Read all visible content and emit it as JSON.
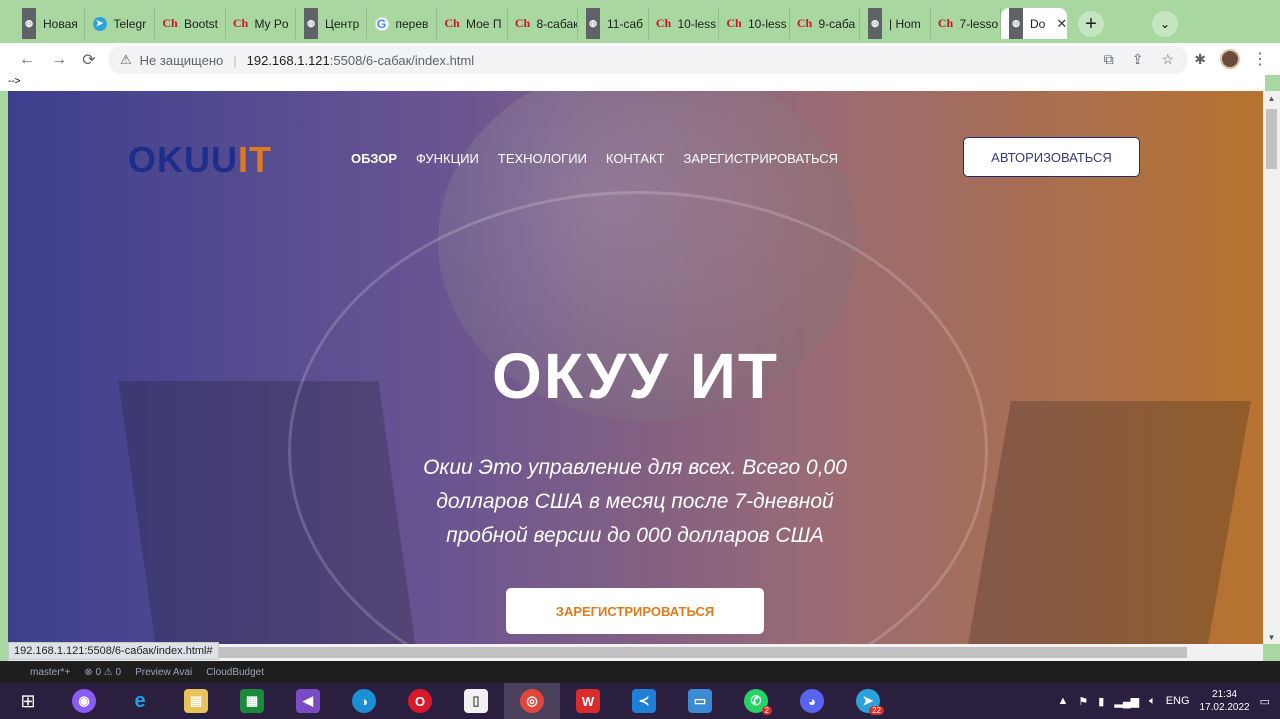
{
  "browser": {
    "tabs": [
      {
        "title": "Новая",
        "icon": "globe"
      },
      {
        "title": "Telegr",
        "icon": "telegram"
      },
      {
        "title": "Bootst",
        "icon": "ch"
      },
      {
        "title": "My Po",
        "icon": "ch"
      },
      {
        "title": "Центр",
        "icon": "globe"
      },
      {
        "title": "перев",
        "icon": "google"
      },
      {
        "title": "Мое П",
        "icon": "ch"
      },
      {
        "title": "8-сабак",
        "icon": "ch"
      },
      {
        "title": "11-саб",
        "icon": "globe"
      },
      {
        "title": "10-less",
        "icon": "ch"
      },
      {
        "title": "10-less",
        "icon": "ch"
      },
      {
        "title": "9-саба",
        "icon": "ch"
      },
      {
        "title": "| Hom",
        "icon": "globe"
      },
      {
        "title": "7-lesso",
        "icon": "ch"
      },
      {
        "title": "Do",
        "icon": "globe",
        "active": true
      }
    ],
    "address": {
      "security_label": "Не защищено",
      "host": "192.168.1.121",
      "path": ":5508/6-сабак/index.html"
    },
    "stray_text": "-->",
    "status_url": "192.168.1.121:5508/6-сабак/index.html#"
  },
  "site": {
    "logo_part1": "OKUU",
    "logo_part2": "IT",
    "nav": [
      "ОБЗОР",
      "ФУНКЦИИ",
      "ТЕХНОЛОГИИ",
      "КОНТАКТ",
      "ЗАРЕГИСТРИРОВАТЬСЯ"
    ],
    "auth_button": "АВТОРИЗОВАТЬСЯ",
    "hero_title": "ОКУУ ИТ",
    "hero_subtitle": "Окии Это управление для всех. Всего 0,00 долларов США в месяц после 7-дневной пробной версии до 000 долларов США",
    "cta_button": "ЗАРЕГИСТРИРОВАТЬСЯ"
  },
  "vscode_strip": [
    "master*+",
    "⊗ 0 ⚠ 0",
    "Preview Avai",
    "CloudBudget"
  ],
  "taskbar": {
    "language": "ENG",
    "time": "21:34",
    "date": "17.02.2022",
    "whatsapp_badge": "2",
    "telegram_badge": "22"
  }
}
